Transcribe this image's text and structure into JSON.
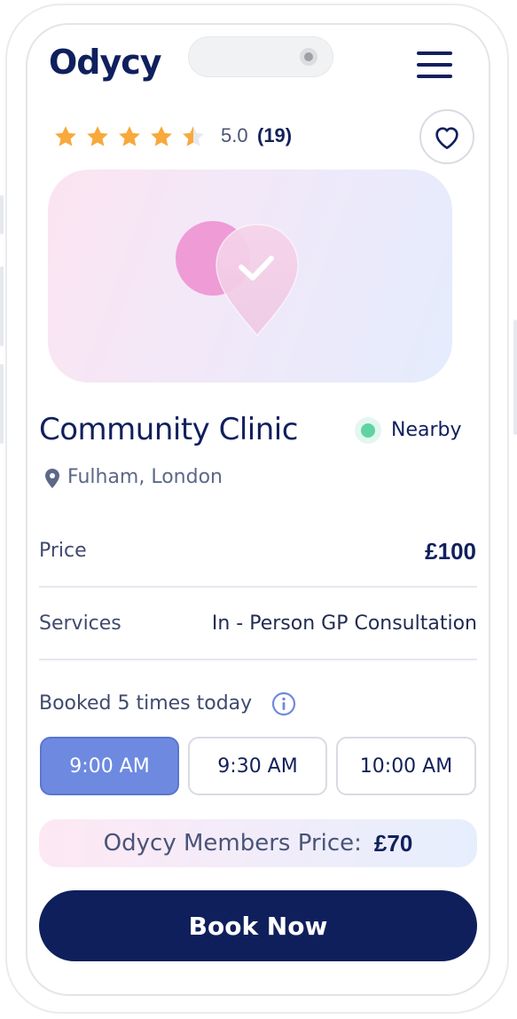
{
  "header": {
    "logo": "Odycy",
    "menu_icon": "hamburger-menu-icon"
  },
  "rating": {
    "stars": 4.5,
    "star_color": "#f7a93b",
    "score": "5.0",
    "count": "(19)",
    "favorite_icon": "heart-outline-icon"
  },
  "hero": {
    "icon": "location-pin-check-icon",
    "gradient": [
      "#fce4f1",
      "#e4ecfd"
    ]
  },
  "clinic": {
    "name": "Community Clinic",
    "status": "Nearby",
    "status_color": "#5fd3a3",
    "location": "Fulham, London"
  },
  "details": {
    "price_label": "Price",
    "price_value": "£100",
    "services_label": "Services",
    "services_value": "In - Person GP Consultation"
  },
  "booking": {
    "booked_text": "Booked 5 times today",
    "slots": [
      "9:00 AM",
      "9:30 AM",
      "10:00 AM"
    ],
    "selected_slot": "9:00 AM",
    "members_label": "Odycy Members Price:",
    "members_price": "£70",
    "book_label": "Book Now",
    "accent_color": "#6d8ae0",
    "button_color": "#0f1f5c"
  }
}
